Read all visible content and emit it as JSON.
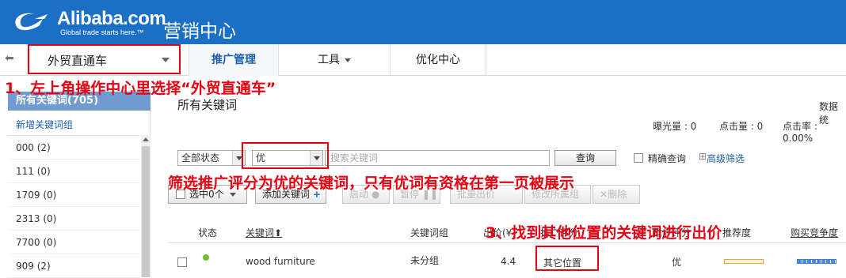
{
  "header": {
    "logo_text": "Alibaba.com",
    "logo_registered": "®",
    "logo_tagline": "Global trade starts here.™",
    "app_title": "营销中心",
    "brand_color": "#1b6fc4"
  },
  "nav": {
    "back_icon": "arrow-left-icon",
    "product_select": "外贸直通车",
    "tabs": [
      {
        "label": "推广管理",
        "active": true
      },
      {
        "label": "工具",
        "dropdown": true
      },
      {
        "label": "优化中心"
      }
    ]
  },
  "annotations": {
    "step1": "1、左上角操作中心里选择“外贸直通车”",
    "step2": "筛选推广评分为优的关键词，只有优词有资格在第一页被展示",
    "step3": "3、找到其他位置的关键词进行出价",
    "color": "#e60012"
  },
  "sidebar": {
    "header": "所有关键词(705)",
    "add_group": "新增关键词组",
    "groups": [
      "000 (2)",
      "111 (0)",
      "1709 (0)",
      "2313 (0)",
      "7700 (0)",
      "909 (2)"
    ]
  },
  "main": {
    "title": "所有关键词",
    "data_label": "数据统",
    "stats": [
      {
        "label": "曝光量 : 0"
      },
      {
        "label": "点击量 : 0"
      },
      {
        "label": "点击率 : 0.00%"
      }
    ]
  },
  "filter": {
    "status_select": "全部状态",
    "score_select": "优",
    "search_placeholder": "搜索关键词",
    "query_button": "查询",
    "exact_query_label": "精确查询",
    "advanced_filter": "高级筛选"
  },
  "toolbar": {
    "select_label": "选中0个",
    "add_keyword": "添加关键词",
    "start": "启动",
    "pause": "暂停",
    "bulk_bid": "批量出价",
    "edit_group": "修改所属组",
    "delete": "删除"
  },
  "table": {
    "headers": {
      "status": "状态",
      "keyword": "关键词",
      "group": "关键词组",
      "bid": "出价(¥)",
      "rank": "推广评分",
      "score": "推广评分",
      "quality": "推荐度",
      "buy": "购买竞争度"
    },
    "rows": [
      {
        "status": "active",
        "keyword": "wood furniture",
        "group": "未分组",
        "bid": "4.4",
        "position": "其它位置",
        "score": "优"
      }
    ]
  }
}
